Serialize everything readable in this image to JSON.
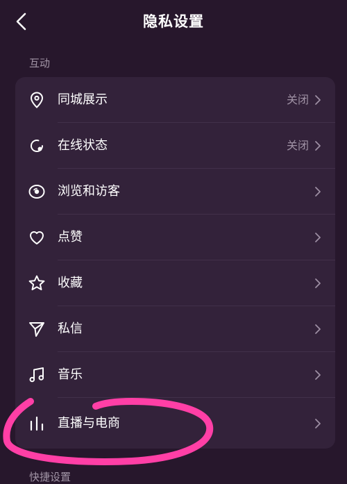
{
  "header": {
    "title": "隐私设置",
    "back_icon": "chevron-left-icon"
  },
  "sections": [
    {
      "label": "互动"
    },
    {
      "label": "快捷设置"
    }
  ],
  "items": [
    {
      "label": "同城展示",
      "value": "关闭",
      "icon": "location-pin-icon"
    },
    {
      "label": "在线状态",
      "value": "关闭",
      "icon": "online-status-icon"
    },
    {
      "label": "浏览和访客",
      "value": "",
      "icon": "eye-icon"
    },
    {
      "label": "点赞",
      "value": "",
      "icon": "heart-icon"
    },
    {
      "label": "收藏",
      "value": "",
      "icon": "star-icon"
    },
    {
      "label": "私信",
      "value": "",
      "icon": "send-icon"
    },
    {
      "label": "音乐",
      "value": "",
      "icon": "music-note-icon"
    },
    {
      "label": "直播与电商",
      "value": "",
      "icon": "bar-chart-icon"
    }
  ],
  "colors": {
    "background": "#27172c",
    "card": "#33223a",
    "annotation": "#ff3fa6"
  }
}
